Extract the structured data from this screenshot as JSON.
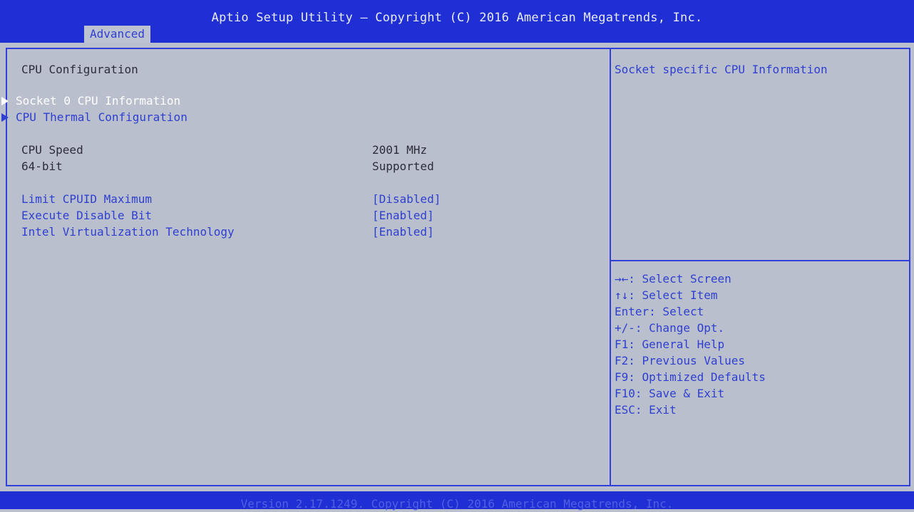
{
  "header": {
    "title": "Aptio Setup Utility – Copyright (C) 2016 American Megatrends, Inc.",
    "active_tab": "Advanced"
  },
  "main": {
    "section_title": "CPU Configuration",
    "submenus": [
      {
        "label": "Socket 0 CPU Information",
        "selected": true
      },
      {
        "label": "CPU Thermal Configuration",
        "selected": false
      }
    ],
    "info_rows": [
      {
        "label": "CPU Speed",
        "value": "2001 MHz"
      },
      {
        "label": "64-bit",
        "value": "Supported"
      }
    ],
    "settings": [
      {
        "label": "Limit CPUID Maximum",
        "value": "[Disabled]"
      },
      {
        "label": "Execute Disable Bit",
        "value": "[Enabled]"
      },
      {
        "label": "Intel Virtualization Technology",
        "value": "[Enabled]"
      }
    ]
  },
  "help_panel": {
    "description": "Socket specific CPU Information",
    "keys": [
      "→←: Select Screen",
      "↑↓: Select Item",
      "Enter: Select",
      "+/-: Change Opt.",
      "F1: General Help",
      "F2: Previous Values",
      "F9: Optimized Defaults",
      "F10: Save & Exit",
      "ESC: Exit"
    ]
  },
  "footer": {
    "version": "Version 2.17.1249. Copyright (C) 2016 American Megatrends, Inc."
  },
  "colors": {
    "bar_blue": "#1f2fd3",
    "background": "#b9bfcd",
    "option_blue": "#2f3fd0",
    "selected_text": "#ffffff"
  }
}
